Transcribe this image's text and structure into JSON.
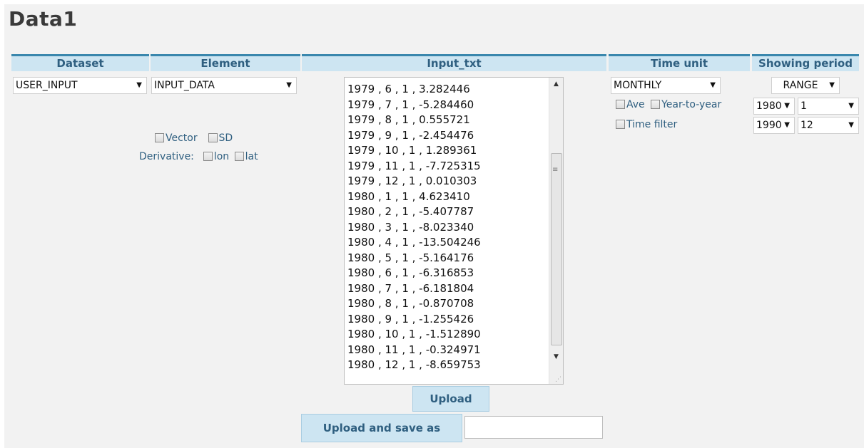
{
  "page": {
    "title": "Data1"
  },
  "headers": {
    "dataset": "Dataset",
    "element": "Element",
    "input_txt": "Input_txt",
    "time_unit": "Time unit",
    "showing_period": "Showing period"
  },
  "dataset_select": {
    "value": "USER_INPUT"
  },
  "element_select": {
    "value": "INPUT_DATA"
  },
  "element_options": {
    "vector_label": "Vector",
    "sd_label": "SD",
    "derivative_label": "Derivative:",
    "lon_label": "lon",
    "lat_label": "lat"
  },
  "input_txt_lines": [
    "1979 , 6 , 1 , 3.282446",
    "1979 , 7 , 1 , -5.284460",
    "1979 , 8 , 1 , 0.555721",
    "1979 , 9 , 1 , -2.454476",
    "1979 , 10 , 1 , 1.289361",
    "1979 , 11 , 1 , -7.725315",
    "1979 , 12 , 1 , 0.010303",
    "1980 , 1 , 1 , 4.623410",
    "1980 , 2 , 1 , -5.407787",
    "1980 , 3 , 1 , -8.023340",
    "1980 , 4 , 1 , -13.504246",
    "1980 , 5 , 1 , -5.164176",
    "1980 , 6 , 1 , -6.316853",
    "1980 , 7 , 1 , -6.181804",
    "1980 , 8 , 1 , -0.870708",
    "1980 , 9 , 1 , -1.255426",
    "1980 , 10 , 1 , -1.512890",
    "1980 , 11 , 1 , -0.324971",
    "1980 , 12 , 1 , -8.659753"
  ],
  "buttons": {
    "upload": "Upload",
    "upload_save_as": "Upload and save as"
  },
  "save_as_input": {
    "value": ""
  },
  "time_unit": {
    "select_value": "MONTHLY",
    "ave_label": "Ave",
    "year_to_year_label": "Year-to-year",
    "time_filter_label": "Time filter"
  },
  "showing_period": {
    "mode": "RANGE",
    "start_year": "1980",
    "start_month": "1",
    "end_year": "1990",
    "end_month": "12"
  },
  "colors": {
    "header_bg": "#cde5f2",
    "header_border": "#3a87ad",
    "header_text": "#2f5f80",
    "page_bg": "#f2f2f2"
  }
}
